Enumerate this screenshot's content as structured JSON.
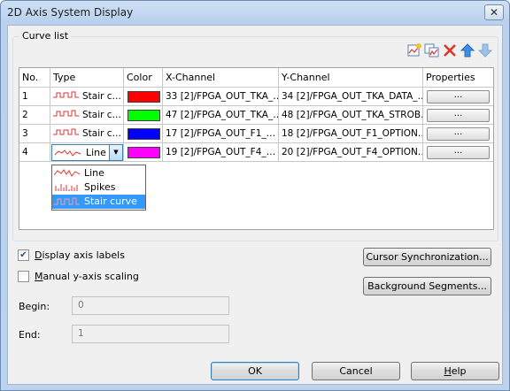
{
  "window": {
    "title": "2D Axis System Display",
    "close_glyph": "✕"
  },
  "curve_list": {
    "group_label": "Curve list",
    "toolbar": [
      {
        "name": "new-curve-icon",
        "tooltip": ""
      },
      {
        "name": "copy-curve-icon",
        "tooltip": ""
      },
      {
        "name": "delete-curve-icon",
        "color": "#d83a2a"
      },
      {
        "name": "move-up-icon",
        "color": "#3d8ee6"
      },
      {
        "name": "move-down-icon",
        "color": "#9fc2e6"
      }
    ],
    "columns": [
      "No.",
      "Type",
      "Color",
      "X-Channel",
      "Y-Channel",
      "Properties"
    ],
    "rows": [
      {
        "no": "1",
        "type": "Stair c…",
        "type_icon": "stair-curve-icon",
        "color": "#ff0000",
        "x": "33  [2]/FPGA_OUT_TKA_…",
        "y": "34  [2]/FPGA_OUT_TKA_DATA_…",
        "props": "..."
      },
      {
        "no": "2",
        "type": "Stair c…",
        "type_icon": "stair-curve-icon",
        "color": "#00ff00",
        "x": "47  [2]/FPGA_OUT_TKA_…",
        "y": "48  [2]/FPGA_OUT_TKA_STROB…",
        "props": "..."
      },
      {
        "no": "3",
        "type": "Stair c…",
        "type_icon": "stair-curve-icon",
        "color": "#0000ff",
        "x": "17  [2]/FPGA_OUT_F1_…",
        "y": "18  [2]/FPGA_OUT_F1_OPTION…",
        "props": "..."
      },
      {
        "no": "4",
        "type": "Line",
        "type_icon": "line-curve-icon",
        "color": "#ff00ff",
        "x": "19  [2]/FPGA_OUT_F4_…",
        "y": "20  [2]/FPGA_OUT_F4_OPTION…",
        "props": "..."
      }
    ],
    "type_dropdown": {
      "arrow_glyph": "▼",
      "options": [
        {
          "label": "Line",
          "icon": "line-curve-icon",
          "selected": false
        },
        {
          "label": "Spikes",
          "icon": "spikes-curve-icon",
          "selected": false
        },
        {
          "label": "Stair curve",
          "icon": "stair-curve-icon",
          "selected": true
        }
      ]
    }
  },
  "options": {
    "display_axis_labels": {
      "label_prefix": "D",
      "label_rest": "isplay axis labels",
      "checked": true,
      "check_glyph": "✔"
    },
    "manual_scaling": {
      "label_prefix": "M",
      "label_rest": "anual  y-axis scaling",
      "checked": false
    },
    "begin": {
      "label": "Begin:",
      "value": "0"
    },
    "end": {
      "label": "End:",
      "value": "1"
    }
  },
  "buttons": {
    "cursor_sync": "Cursor Synchronization...",
    "background_segments": "Background Segments...",
    "ok": "OK",
    "cancel": "Cancel",
    "help_prefix": "H",
    "help_rest": "elp"
  }
}
